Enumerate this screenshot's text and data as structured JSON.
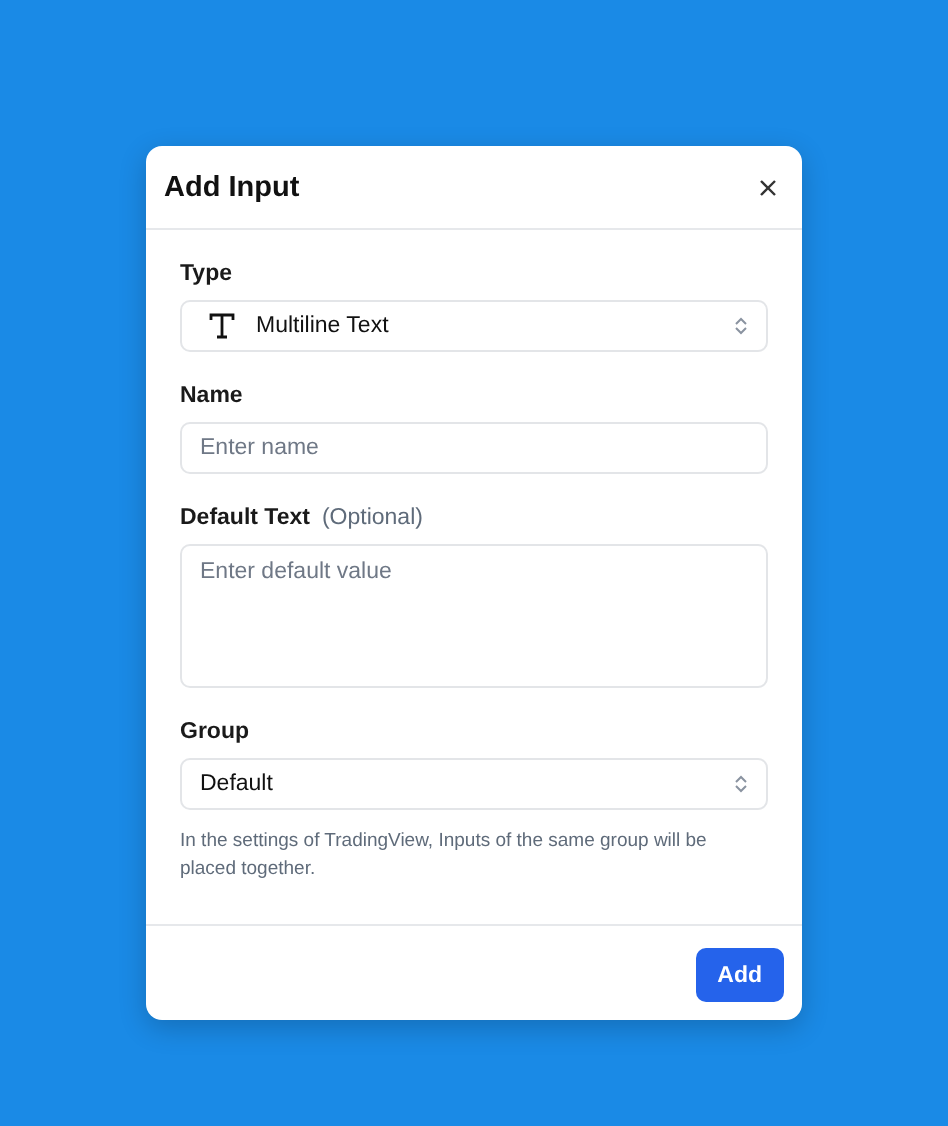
{
  "dialog": {
    "title": "Add Input",
    "fields": [
      {
        "kind": "select",
        "label": "Type",
        "value": "Multiline Text"
      },
      {
        "kind": "input",
        "label": "Name",
        "placeholder": "Enter name"
      },
      {
        "kind": "textarea",
        "label": "Default Text",
        "hint": "(Optional)",
        "placeholder": "Enter default value"
      },
      {
        "kind": "select",
        "label": "Group",
        "value": "Default",
        "help": "In the settings of TradingView, Inputs of the same group will be placed together."
      }
    ],
    "buttons": [
      "Add"
    ]
  }
}
